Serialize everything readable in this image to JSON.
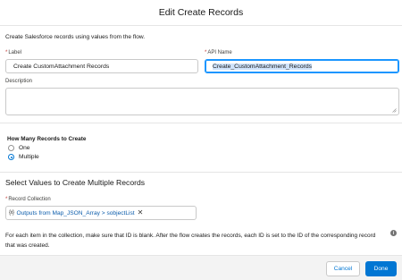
{
  "modal": {
    "title": "Edit Create Records"
  },
  "intro_text": "Create Salesforce records using values from the flow.",
  "label_field": {
    "required_mark": "*",
    "label": "Label",
    "value": "Create CustomAttachment Records"
  },
  "api_name_field": {
    "required_mark": "*",
    "label": "API Name",
    "value": "Create_CustomAttachment_Records"
  },
  "description_field": {
    "label": "Description",
    "value": ""
  },
  "records_to_create": {
    "title": "How Many Records to Create",
    "options": [
      {
        "label": "One",
        "selected": false
      },
      {
        "label": "Multiple",
        "selected": true
      }
    ]
  },
  "multiple_section": {
    "title": "Select Values to Create Multiple Records",
    "record_collection": {
      "required_mark": "*",
      "label": "Record Collection",
      "pill_icon": "{x}",
      "pill_text": "Outputs from Map_JSON_Array > sobjectList",
      "pill_remove": "✕"
    },
    "note": "For each item in the collection, make sure that ID is blank. After the flow creates the records, each ID is set to the ID of the corresponding record that was created.",
    "info_icon": "i"
  },
  "footer": {
    "cancel_label": "Cancel",
    "done_label": "Done"
  },
  "colors": {
    "brand_blue": "#0176d3",
    "required_red": "#c23934",
    "focus_blue": "#1b96ff"
  }
}
